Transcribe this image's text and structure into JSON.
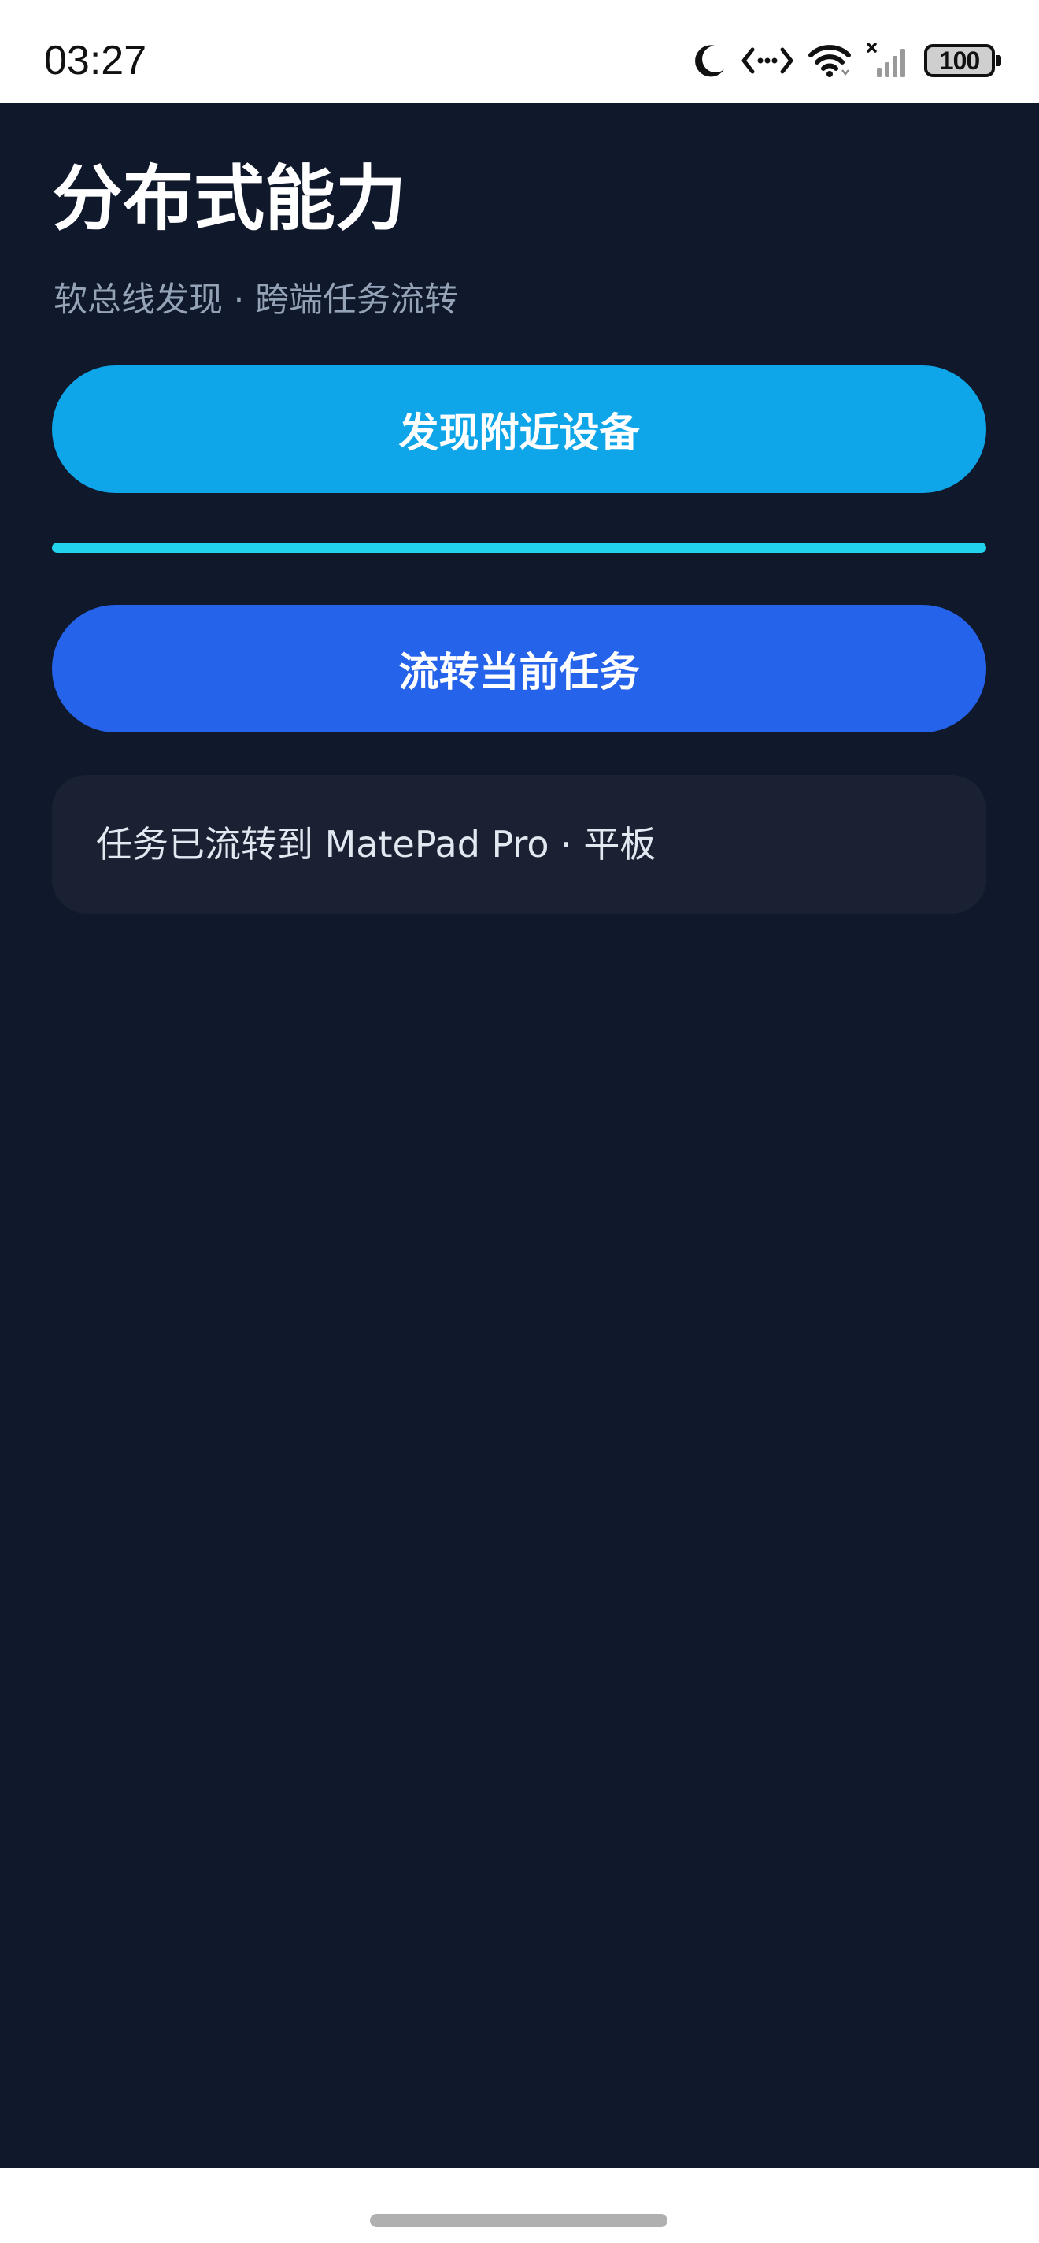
{
  "status_bar": {
    "time": "03:27",
    "battery_level": "100",
    "icons": [
      "moon-icon",
      "data-transfer-icon",
      "wifi-icon",
      "signal-no-sim-icon",
      "battery-icon"
    ]
  },
  "page": {
    "title": "分布式能力",
    "subtitle": "软总线发现 · 跨端任务流转"
  },
  "actions": {
    "discover_label": "发现附近设备",
    "flow_label": "流转当前任务"
  },
  "progress": {
    "value": 1.0
  },
  "status_card": {
    "text": "任务已流转到 MatePad Pro · 平板"
  },
  "colors": {
    "background": "#10182b",
    "discover_button": "#0ea5e9",
    "flow_button": "#2563eb",
    "progress": "#22d3ee",
    "card": "#1a2133"
  }
}
